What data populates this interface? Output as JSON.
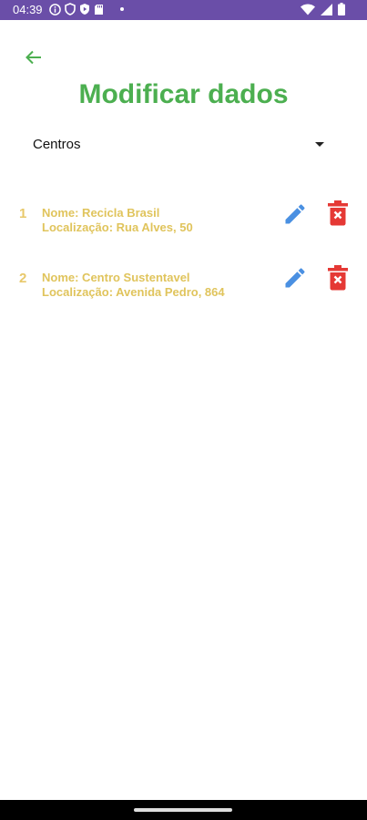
{
  "status_bar": {
    "time": "04:39"
  },
  "header": {
    "title": "Modificar dados"
  },
  "filter": {
    "selected": "Centros"
  },
  "items": [
    {
      "index": "1",
      "name": "Nome: Recicla Brasil",
      "location": "Localização: Rua Alves, 50"
    },
    {
      "index": "2",
      "name": "Nome: Centro Sustentavel",
      "location": "Localização: Avenida Pedro, 864"
    }
  ],
  "colors": {
    "accent": "#4caf50",
    "item_text": "#e0c45c",
    "edit": "#4a90e2",
    "delete": "#e53935",
    "status_bar": "#6a4ea8"
  }
}
